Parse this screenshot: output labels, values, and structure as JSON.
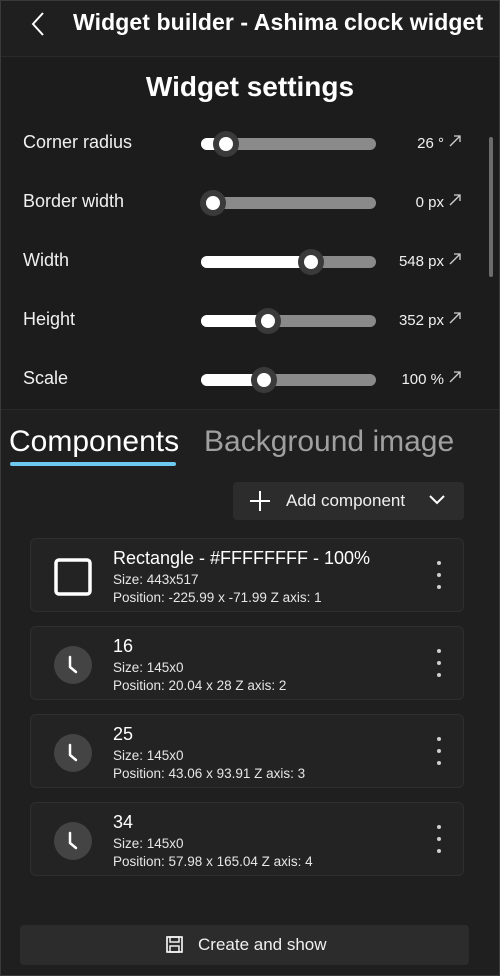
{
  "window": {
    "title": "Widget builder - Ashima clock widget"
  },
  "settings": {
    "title": "Widget settings",
    "rows": [
      {
        "label": "Corner radius",
        "value": "26 °",
        "level": 0.14
      },
      {
        "label": "Border width",
        "value": "0 px",
        "level": 0.07
      },
      {
        "label": "Width",
        "value": "548 px",
        "level": 0.63
      },
      {
        "label": "Height",
        "value": "352 px",
        "level": 0.38
      },
      {
        "label": "Scale",
        "value": "100 %",
        "level": 0.36
      }
    ]
  },
  "tabs": {
    "components": "Components",
    "background": "Background image"
  },
  "add_component": {
    "label": "Add component"
  },
  "components": [
    {
      "title": "Rectangle - #FFFFFFFF - 100%",
      "size": "Size: 443x517",
      "position": "Position: -225.99 x -71.99  Z axis: 1",
      "icon": "rectangle-icon"
    },
    {
      "title": "16",
      "size": "Size: 145x0",
      "position": "Position: 20.04 x 28  Z axis: 2",
      "icon": "clock-icon"
    },
    {
      "title": "25",
      "size": "Size: 145x0",
      "position": "Position: 43.06 x 93.91  Z axis: 3",
      "icon": "clock-icon"
    },
    {
      "title": "34",
      "size": "Size: 145x0",
      "position": "Position: 57.98 x 165.04  Z axis: 4",
      "icon": "clock-icon"
    }
  ],
  "footer": {
    "create_label": "Create and show"
  },
  "colors": {
    "accent": "#6fc8ee",
    "background": "#1f1f1f",
    "card": "#232323"
  }
}
